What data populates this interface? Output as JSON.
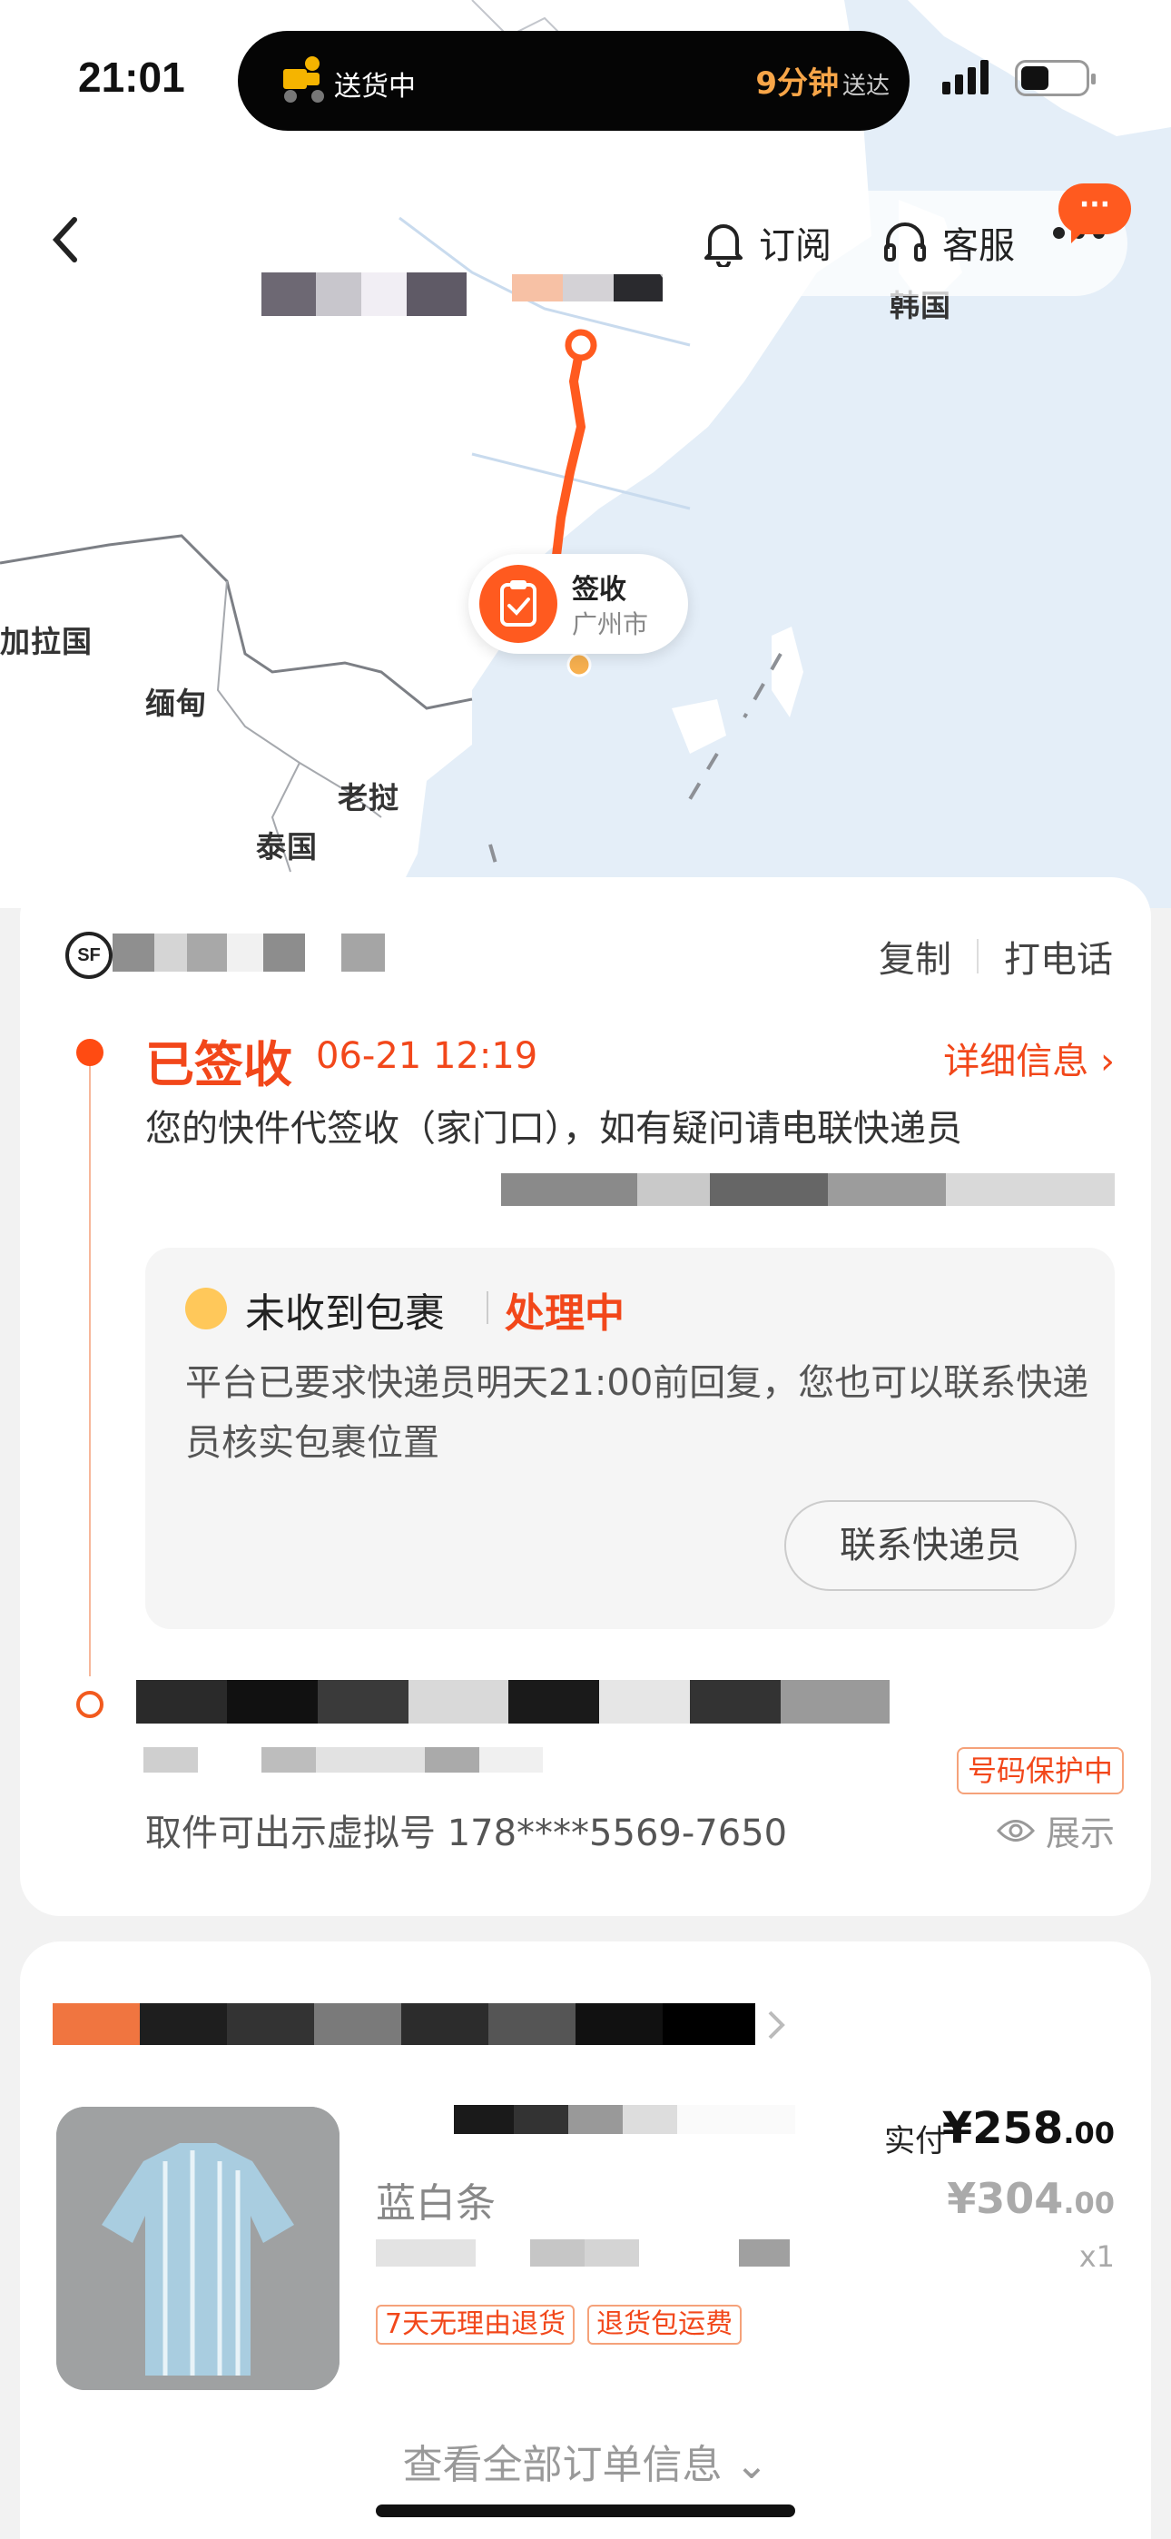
{
  "status_bar": {
    "time": "21:01"
  },
  "island": {
    "label": "送货中",
    "eta": "9分钟",
    "eta_suffix": "送达"
  },
  "nav": {
    "subscribe_label": "订阅",
    "service_label": "客服",
    "chat_badge": "···"
  },
  "map": {
    "labels": {
      "korea": "韩国",
      "bangladesh": "加拉国",
      "myanmar": "缅甸",
      "laos": "老挝",
      "thailand": "泰国"
    },
    "marker": {
      "title": "签收",
      "city": "广州市"
    }
  },
  "tracking": {
    "logo_text": "SF",
    "copy_label": "复制",
    "call_label": "打电话",
    "status": "已签收",
    "status_time": "06-21 12:19",
    "detail_label": "详细信息 ›",
    "status_desc": "您的快件代签收（家门口），如有疑问请电联快递员",
    "issue": {
      "title": "未收到包裹",
      "state": "处理中",
      "text": "平台已要求快递员明天21:00前回复，您也可以联系快递员核实包裹位置",
      "button": "联系快递员"
    },
    "protect_badge": "号码保护中",
    "virtual_number": "取件可出示虚拟号 178****5569-7650",
    "show_label": "展示"
  },
  "order": {
    "product_name": "蓝白条",
    "paid_label": "实付",
    "paid_price_int": "¥258",
    "paid_price_dec": ".00",
    "orig_price_int": "¥304",
    "orig_price_dec": ".00",
    "qty": "x1",
    "tags": [
      "7天无理由退货",
      "退货包运费"
    ],
    "view_all": "查看全部订单信息 ⌄"
  },
  "colors": {
    "accent": "#f2471a",
    "route": "#ff5a1f",
    "map_land": "#ffffff",
    "map_sea": "#e4eef8"
  }
}
